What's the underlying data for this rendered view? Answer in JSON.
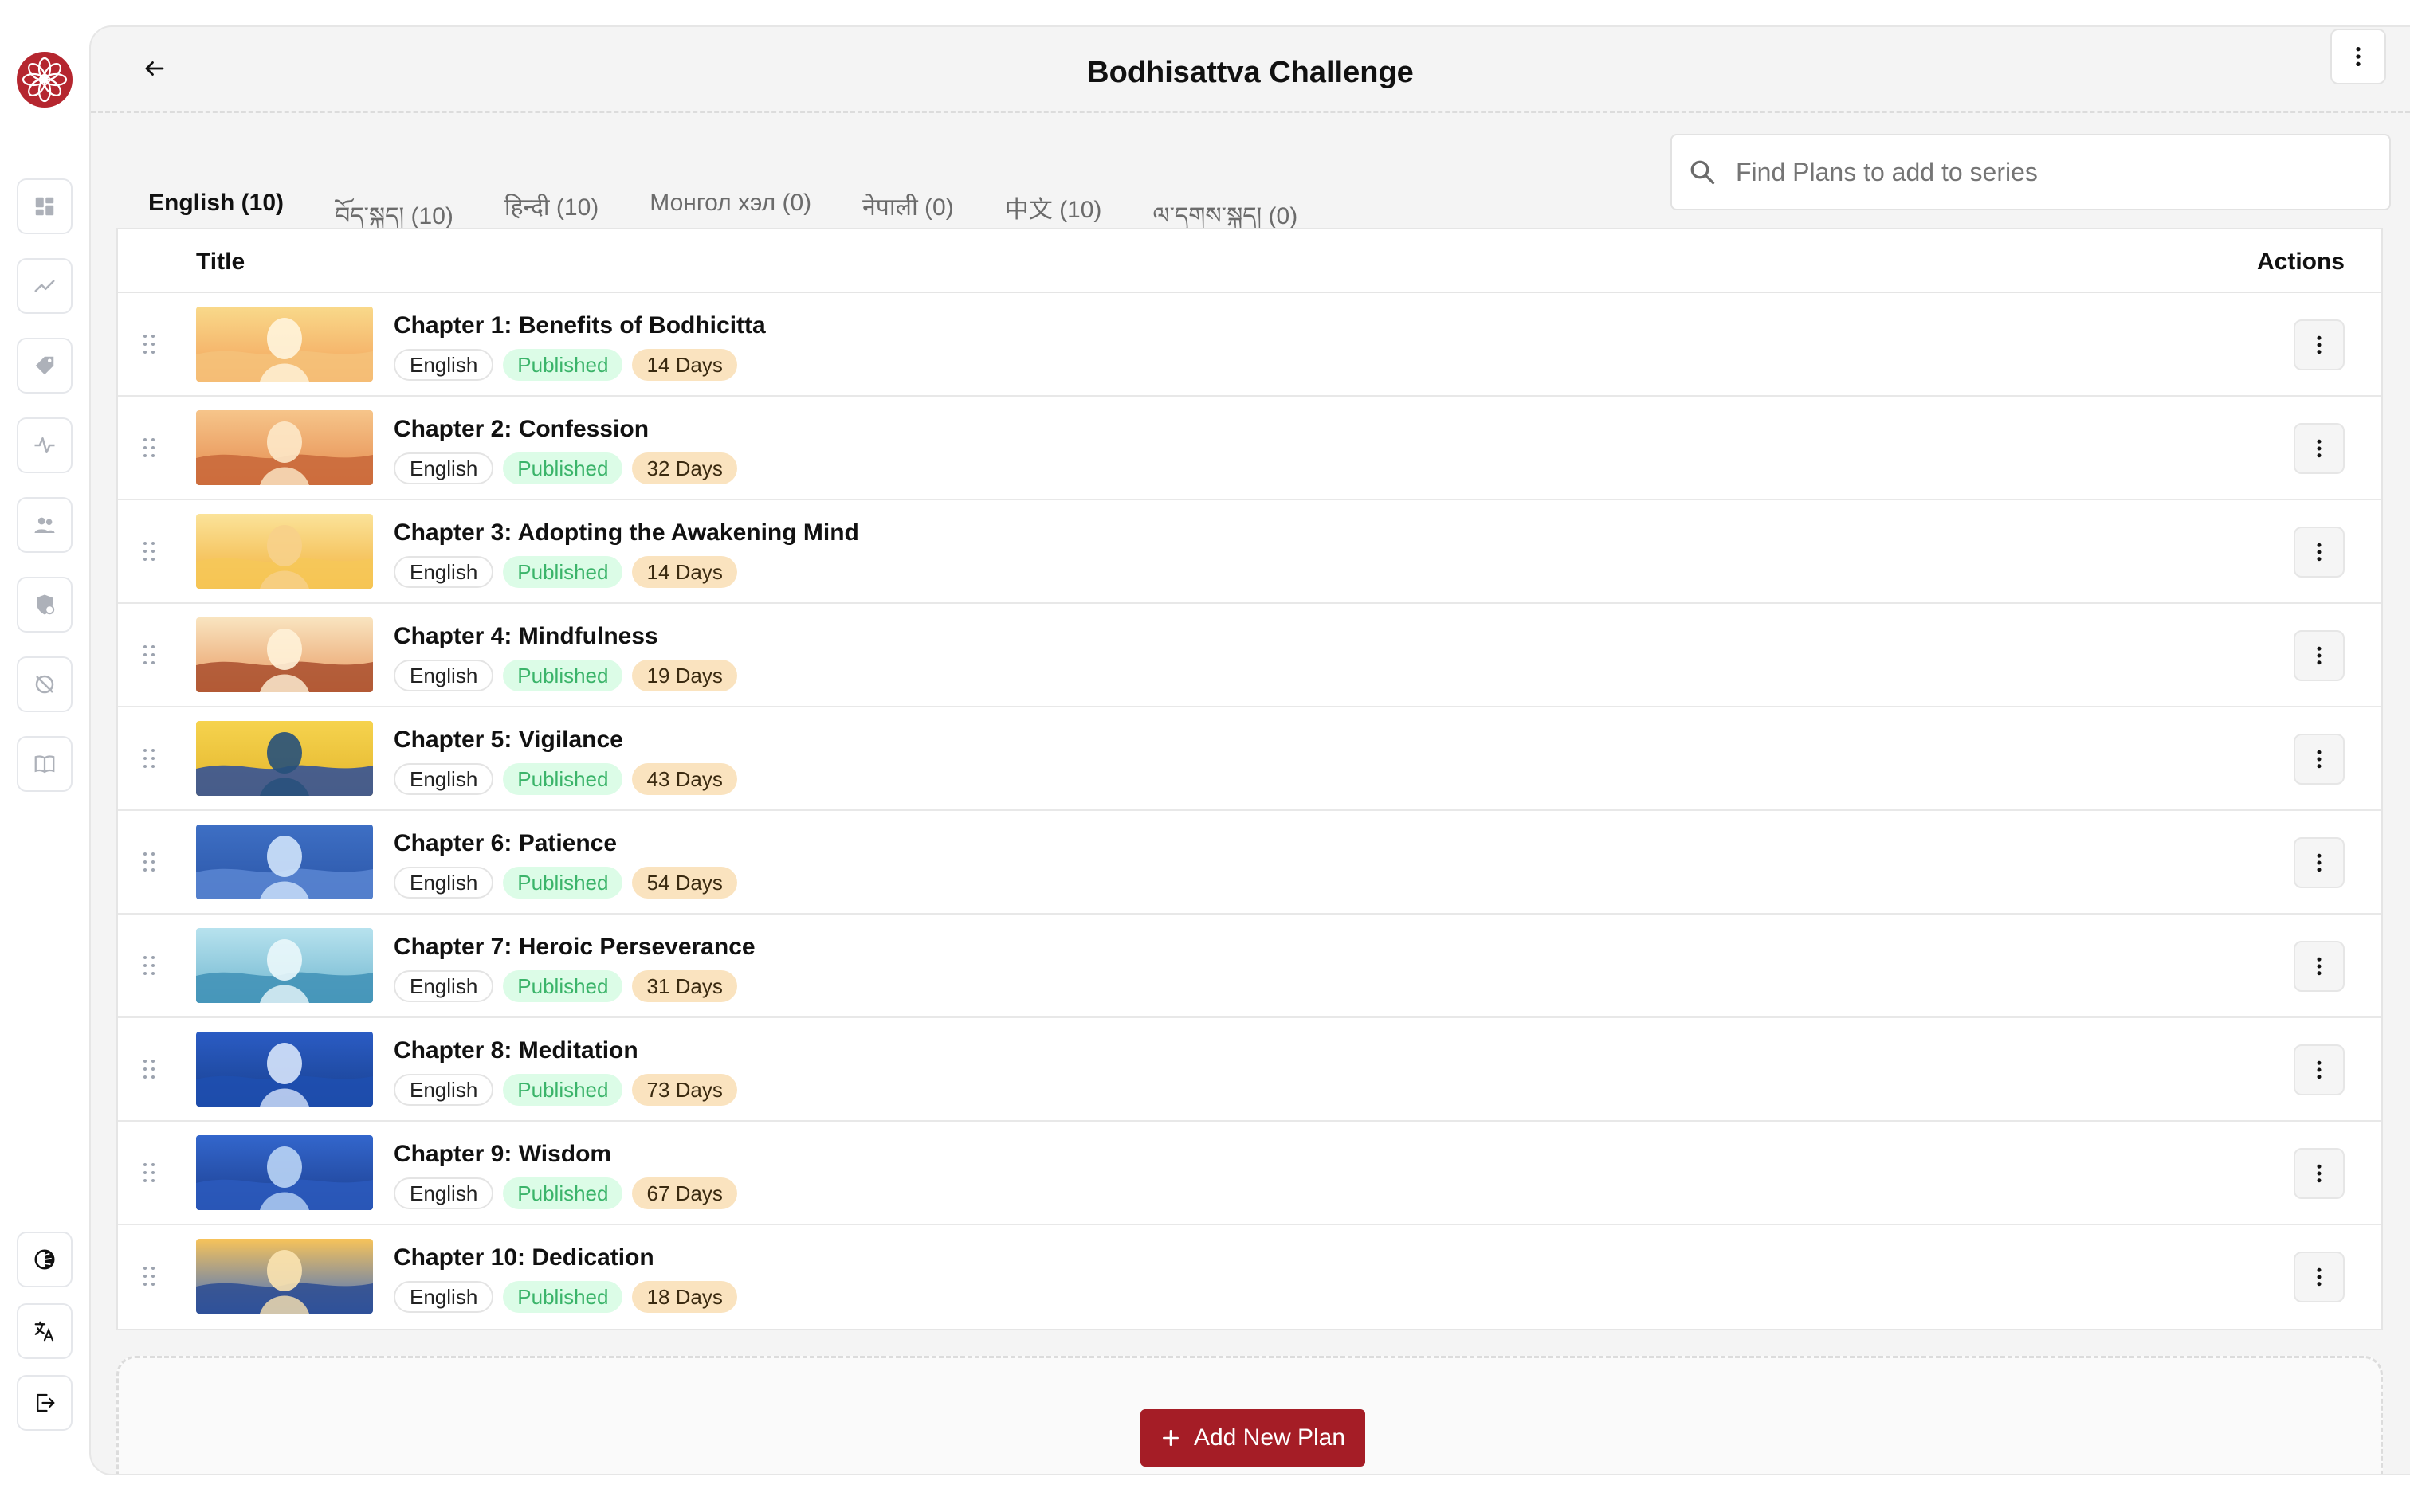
{
  "header": {
    "title": "Bodhisattva Challenge"
  },
  "tabs": [
    {
      "label": "English (10)",
      "active": true
    },
    {
      "label": "བོད་སྐད། (10)",
      "active": false
    },
    {
      "label": "हिन्दी (10)",
      "active": false
    },
    {
      "label": "Монгол хэл (0)",
      "active": false
    },
    {
      "label": "नेपाली (0)",
      "active": false
    },
    {
      "label": "中文 (10)",
      "active": false
    },
    {
      "label": "ལ་དྭགས་སྐད། (0)",
      "active": false
    }
  ],
  "search": {
    "placeholder": "Find Plans to add to series",
    "value": ""
  },
  "table": {
    "col_title": "Title",
    "col_actions": "Actions",
    "rows": [
      {
        "title": "Chapter 1: Benefits of Bodhicitta",
        "language": "English",
        "status": "Published",
        "duration": "14 Days"
      },
      {
        "title": "Chapter 2: Confession",
        "language": "English",
        "status": "Published",
        "duration": "32 Days"
      },
      {
        "title": "Chapter 3: Adopting the Awakening Mind",
        "language": "English",
        "status": "Published",
        "duration": "14 Days"
      },
      {
        "title": "Chapter 4: Mindfulness",
        "language": "English",
        "status": "Published",
        "duration": "19 Days"
      },
      {
        "title": "Chapter 5: Vigilance",
        "language": "English",
        "status": "Published",
        "duration": "43 Days"
      },
      {
        "title": "Chapter 6: Patience",
        "language": "English",
        "status": "Published",
        "duration": "54 Days"
      },
      {
        "title": "Chapter 7: Heroic Perseverance",
        "language": "English",
        "status": "Published",
        "duration": "31 Days"
      },
      {
        "title": "Chapter 8: Meditation",
        "language": "English",
        "status": "Published",
        "duration": "73 Days"
      },
      {
        "title": "Chapter 9: Wisdom",
        "language": "English",
        "status": "Published",
        "duration": "67 Days"
      },
      {
        "title": "Chapter 10: Dedication",
        "language": "English",
        "status": "Published",
        "duration": "18 Days"
      }
    ]
  },
  "add_button": {
    "label": "Add New Plan"
  },
  "sidebar": {
    "nav_icons": [
      "dashboard-icon",
      "chart-trend-icon",
      "tag-icon",
      "pulse-icon",
      "users-icon",
      "shield-user-icon",
      "eye-off-icon",
      "book-icon"
    ],
    "bottom_icons": [
      "theme-toggle-icon",
      "translate-icon",
      "logout-icon"
    ]
  },
  "colors": {
    "brand": "#b5262f",
    "button": "#a51d26",
    "published_bg": "#dcfce7",
    "published_text": "#3bb46a",
    "days_bg": "#fae3bf"
  }
}
